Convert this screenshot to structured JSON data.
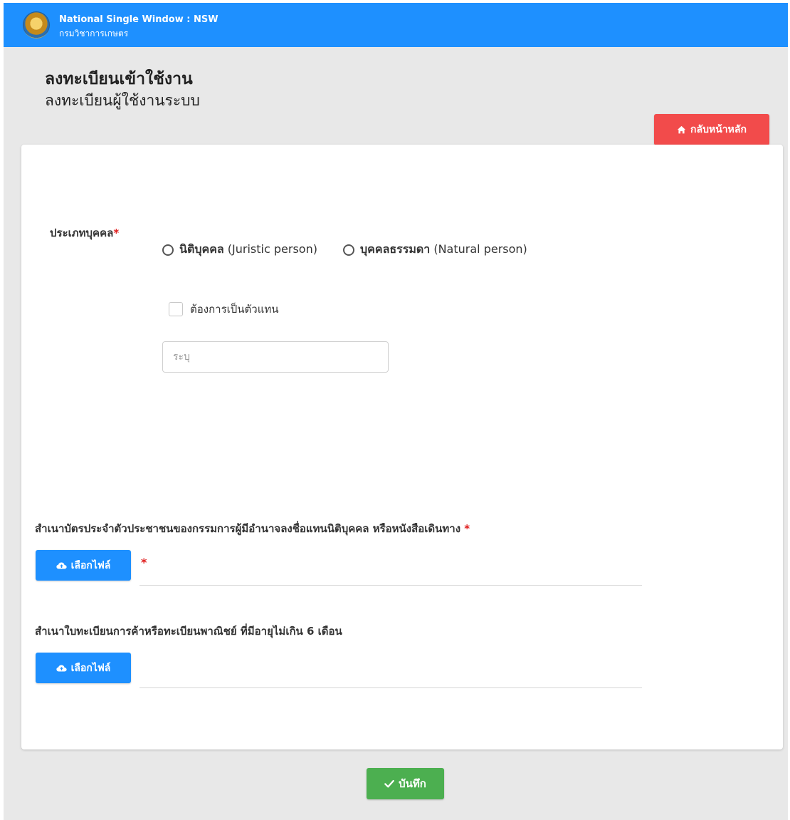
{
  "header": {
    "app_title": "National Single Window : NSW",
    "org_name": "กรมวิชาการเกษตร",
    "logo_icon": "department-seal-icon",
    "bar_color": "#1e90ff"
  },
  "page": {
    "title": "ลงทะเบียนเข้าใช้งาน",
    "subtitle": "ลงทะเบียนผู้ใช้งานระบบ"
  },
  "home_button": {
    "label": "กลับหน้าหลัก",
    "icon": "home-icon",
    "color": "#f24b4b"
  },
  "form": {
    "person_type": {
      "label": "ประเภทบุคคล",
      "required_mark": "*",
      "options": [
        {
          "th": "นิติบุคคล",
          "en": "(Juristic person)",
          "selected": false
        },
        {
          "th": "บุคคลธรรมดา",
          "en": "(Natural person)",
          "selected": false
        }
      ]
    },
    "agent_checkbox": {
      "label": "ต้องการเป็นตัวแทน",
      "checked": false
    },
    "agent_input": {
      "placeholder": "ระบุ",
      "value": ""
    },
    "uploads": [
      {
        "label": "สำเนาบัตรประจำตัวประชาชนของกรรมการผู้มีอำนาจลงชื่อแทนนิติบุคคล หรือหนังสือเดินทาง",
        "required_mark": "*",
        "button_label": "เลือกไฟล์",
        "field_required_mark": "*",
        "file_name": ""
      },
      {
        "label": "สำเนาใบทะเบียนการค้าหรือทะเบียนพาณิชย์ ที่มีอายุไม่เกิน 6 เดือน",
        "button_label": "เลือกไฟล์",
        "file_name": ""
      }
    ],
    "upload_icon": "cloud-upload-icon",
    "upload_button_color": "#1e90ff"
  },
  "save_button": {
    "label": "บันทึก",
    "icon": "check-icon",
    "color": "#4caf50"
  },
  "colors": {
    "page_background": "#e8e8e8",
    "required": "#e01e1e"
  }
}
